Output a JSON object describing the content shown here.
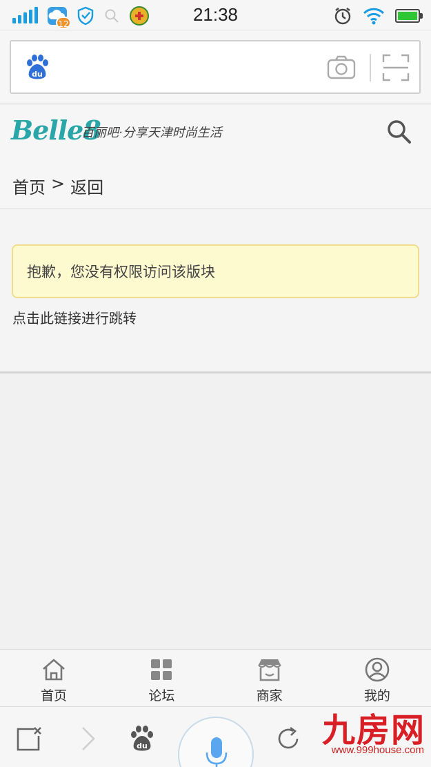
{
  "status_bar": {
    "time": "21:38",
    "notification_count": "12",
    "colors": {
      "signal": "#1a9de1",
      "battery": "#2ec632"
    }
  },
  "browser": {
    "search_value": "",
    "icons": [
      "du-logo-icon",
      "camera-icon",
      "scan-icon"
    ]
  },
  "site": {
    "logo": "Belle8",
    "slogan": "百丽吧·分享天津时尚生活",
    "brand_color": "#2aa6a8"
  },
  "breadcrumb": {
    "home": "首页",
    "separator": ">",
    "back": "返回"
  },
  "content": {
    "notice": "抱歉，您没有权限访问该版块",
    "redirect_link": "点击此链接进行跳转",
    "notice_bg": "#fefad0",
    "notice_border": "#f1dc8c"
  },
  "site_nav": {
    "items": [
      {
        "label": "首页",
        "icon": "home-icon"
      },
      {
        "label": "论坛",
        "icon": "forum-grid-icon"
      },
      {
        "label": "商家",
        "icon": "store-icon"
      },
      {
        "label": "我的",
        "icon": "user-icon"
      }
    ]
  },
  "toolbar": {
    "icons": [
      "close-tab-icon",
      "forward-icon",
      "du-paw-icon",
      "microphone-icon",
      "refresh-icon"
    ]
  },
  "watermark": {
    "brand": "九房网",
    "url": "www.999house.com"
  }
}
